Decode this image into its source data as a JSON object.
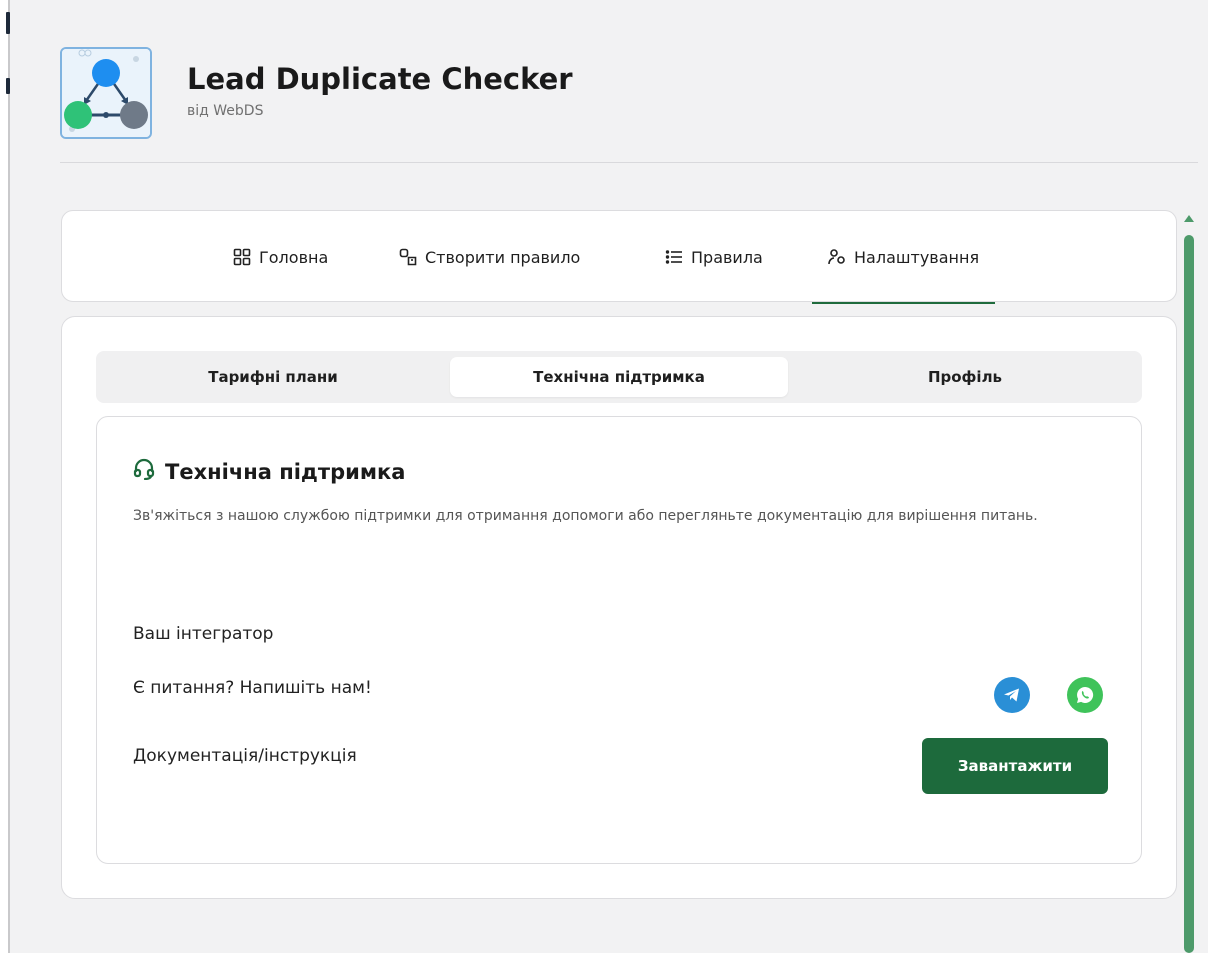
{
  "app": {
    "title": "Lead Duplicate Checker",
    "subtitle": "від WebDS",
    "logo": "network-nodes-logo"
  },
  "nav": {
    "tabs": [
      {
        "label": "Головна",
        "icon": "grid-icon"
      },
      {
        "label": "Створити правило",
        "icon": "create-rule-icon"
      },
      {
        "label": "Правила",
        "icon": "list-icon"
      },
      {
        "label": "Налаштування",
        "icon": "user-settings-icon"
      }
    ],
    "active": "Налаштування"
  },
  "subtabs": {
    "items": [
      "Тарифні плани",
      "Технічна підтримка",
      "Профіль"
    ],
    "active": "Технічна підтримка"
  },
  "support": {
    "title": "Технічна підтримка",
    "description": "Зв'яжіться з нашою службою підтримки для отримання допомоги або перегляньте документацію для вирішення питань.",
    "integrator_label": "Ваш інтегратор",
    "contact_label": "Є питання? Напишіть нам!",
    "docs_label": "Документація/інструкція",
    "download_button": "Завантажити",
    "icons": [
      "headset-icon",
      "telegram-icon",
      "whatsapp-icon"
    ]
  },
  "colors": {
    "accent": "#1d6a3c",
    "telegram": "#2a8fd6",
    "whatsapp": "#3fc35a",
    "scrollbar": "#4d9a6a"
  }
}
